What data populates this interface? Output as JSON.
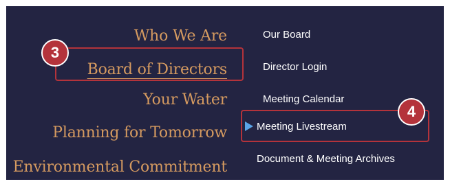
{
  "left_menu": {
    "items": [
      {
        "label": "Who We Are"
      },
      {
        "label": "Board of Directors"
      },
      {
        "label": "Your Water"
      },
      {
        "label": "Planning for Tomorrow"
      },
      {
        "label": "Environmental Commitment"
      }
    ]
  },
  "right_menu": {
    "items": [
      {
        "label": "Our Board"
      },
      {
        "label": "Director Login"
      },
      {
        "label": "Meeting Calendar"
      },
      {
        "label": "Meeting Livestream"
      },
      {
        "label": "Document & Meeting Archives"
      }
    ]
  },
  "annotations": {
    "step3": "3",
    "step4": "4"
  },
  "colors": {
    "background": "#232442",
    "left_text": "#d59a60",
    "right_text": "#ffffff",
    "highlight": "#b4333b",
    "arrow": "#5aa5e8"
  }
}
